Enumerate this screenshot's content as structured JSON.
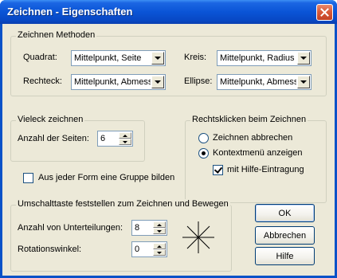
{
  "window": {
    "title": "Zeichnen - Eigenschaften"
  },
  "methods_group": {
    "label": "Zeichnen Methoden",
    "quadrat_label": "Quadrat:",
    "quadrat_value": "Mittelpunkt, Seite",
    "rechteck_label": "Rechteck:",
    "rechteck_value": "Mittelpunkt, Abmess",
    "kreis_label": "Kreis:",
    "kreis_value": "Mittelpunkt, Radius",
    "ellipse_label": "Ellipse:",
    "ellipse_value": "Mittelpunkt, Abmess"
  },
  "polygon_group": {
    "label": "Vieleck zeichnen",
    "sides_label": "Anzahl der Seiten:",
    "sides_value": "6"
  },
  "rightclick_group": {
    "label": "Rechtsklicken beim Zeichnen",
    "option_cancel": "Zeichnen abbrechen",
    "option_context": "Kontextmenü anzeigen",
    "option_context_selected": true,
    "help_entry_label": "mit Hilfe-Eintragung",
    "help_entry_checked": true
  },
  "group_checkbox": {
    "label": "Aus jeder Form eine Gruppe bilden",
    "checked": false
  },
  "shift_group": {
    "label": "Umschalttaste feststellen zum Zeichnen und Bewegen",
    "divisions_label": "Anzahl von Unterteilungen:",
    "divisions_value": "8",
    "rotation_label": "Rotationswinkel:",
    "rotation_value": "0"
  },
  "buttons": {
    "ok": "OK",
    "cancel": "Abbrechen",
    "help": "Hilfe"
  }
}
